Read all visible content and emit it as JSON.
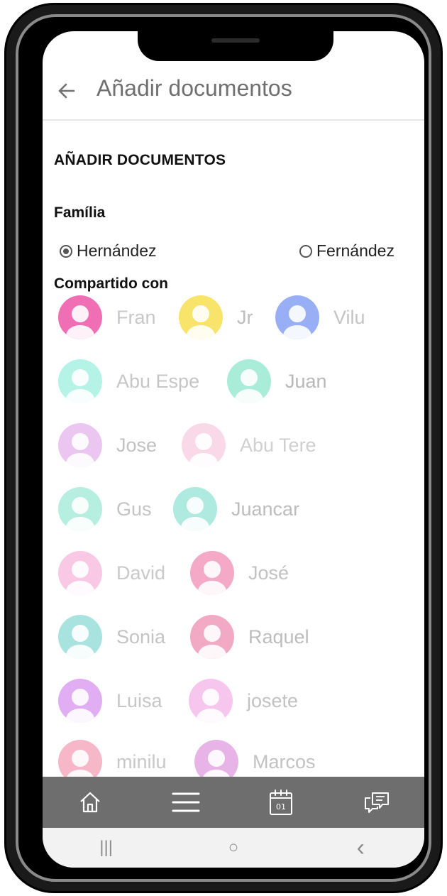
{
  "header": {
    "title": "Añadir documentos"
  },
  "section_title": "AÑADIR DOCUMENTOS",
  "family": {
    "label": "Família",
    "options": [
      {
        "label": "Hernández",
        "selected": true
      },
      {
        "label": "Fernández",
        "selected": false
      }
    ]
  },
  "shared": {
    "label": "Compartido con",
    "members": [
      {
        "name": "Fran",
        "color": "#f06fb4"
      },
      {
        "name": "Jr",
        "color": "#f8e46b"
      },
      {
        "name": "Vilu",
        "color": "#98aef5"
      },
      {
        "name": "Abu Espe",
        "color": "#b4f3e6"
      },
      {
        "name": "Juan",
        "color": "#a9ecd8"
      },
      {
        "name": "Jose",
        "color": "#ebc6f0"
      },
      {
        "name": "Abu Tere",
        "color": "#f9d9e7"
      },
      {
        "name": "Gus",
        "color": "#b6efdf"
      },
      {
        "name": "Juancar",
        "color": "#aeeadf"
      },
      {
        "name": "David",
        "color": "#f9c8e4"
      },
      {
        "name": "José",
        "color": "#f4a9c6"
      },
      {
        "name": "Sonia",
        "color": "#a9e3e0"
      },
      {
        "name": "Raquel",
        "color": "#f2a9c3"
      },
      {
        "name": "Luisa",
        "color": "#e1aef4"
      },
      {
        "name": "josete",
        "color": "#f7c6ef"
      },
      {
        "name": "minilu",
        "color": "#f6b8c8"
      },
      {
        "name": "Marcos",
        "color": "#e8b3e6"
      }
    ]
  },
  "bottom_nav": {
    "icons": [
      "home-icon",
      "menu-icon",
      "calendar-icon",
      "chat-icon"
    ],
    "calendar_day": "01",
    "bg_color": "#6e6e6e"
  },
  "system_nav": {
    "recent": "|||",
    "home": "○",
    "back": "‹"
  }
}
